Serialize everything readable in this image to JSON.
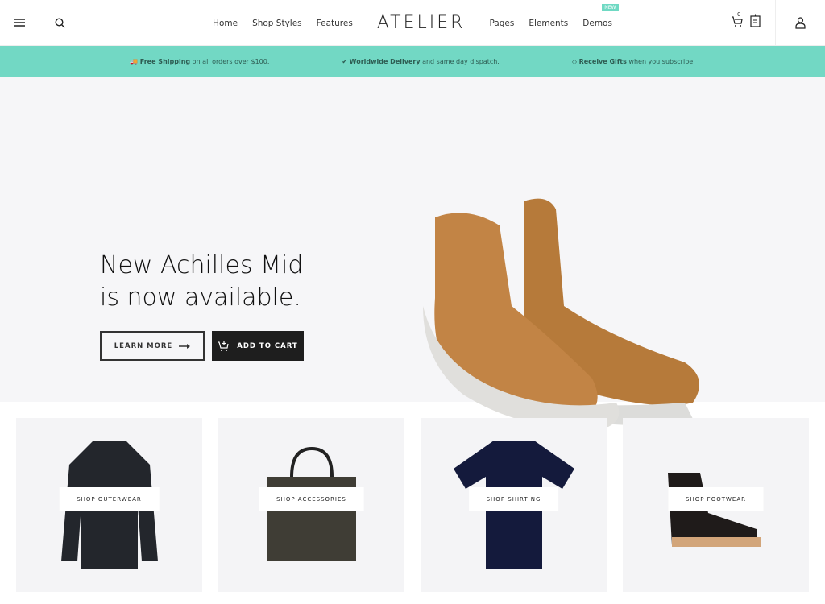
{
  "header": {
    "logo": "ATELIER",
    "nav": [
      "Home",
      "Shop Styles",
      "Features",
      "Pages",
      "Elements",
      "Demos"
    ],
    "new_badge": "NEW",
    "cart_count": "0"
  },
  "strip": [
    {
      "bold": "Free Shipping",
      "rest": " on all orders over $100.",
      "icon": "truck-icon"
    },
    {
      "bold": "Worldwide Delivery",
      "rest": " and same day dispatch.",
      "icon": "check-icon"
    },
    {
      "bold": "Receive Gifts",
      "rest": " when you subscribe.",
      "icon": "diamond-icon"
    }
  ],
  "hero": {
    "line1": "New Achilles Mid",
    "line2": "is now available.",
    "learn_more": "LEARN MORE",
    "add_to_cart": "ADD TO CART"
  },
  "categories": [
    "SHOP OUTERWEAR",
    "SHOP ACCESSORIES",
    "SHOP SHIRTING",
    "SHOP FOOTWEAR"
  ],
  "colors": {
    "accent": "#72d8c4",
    "dark": "#1e1e1e"
  }
}
